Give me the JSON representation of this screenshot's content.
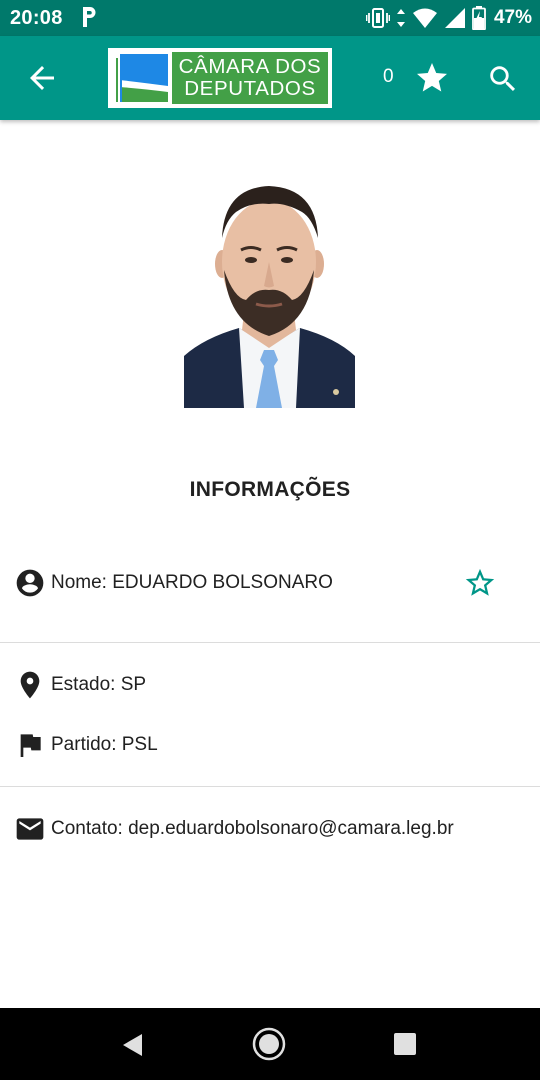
{
  "status_bar": {
    "time": "20:08",
    "battery": "47%",
    "icons": [
      "parking-notification-icon",
      "vibrate-icon",
      "data-arrows-icon",
      "wifi-icon",
      "signal-icon",
      "battery-charging-icon"
    ]
  },
  "app_bar": {
    "logo_line1": "CÂMARA DOS",
    "logo_line2": "DEPUTADOS",
    "favorites_count": "0",
    "color": "#009688",
    "status_color": "#00796b"
  },
  "profile": {
    "section_title": "INFORMAÇÕES",
    "name": "Nome: EDUARDO BOLSONARO",
    "state": "Estado: SP",
    "party": "Partido: PSL",
    "contact": "Contato: dep.eduardobolsonaro@camara.leg.br",
    "photo": "deputy-portrait"
  },
  "colors": {
    "accent": "#009688",
    "logo_green": "#43a047",
    "logo_blue": "#1e88e5"
  },
  "nav_bar": {
    "icons": [
      "back-triangle-icon",
      "home-circle-icon",
      "recents-square-icon"
    ]
  }
}
